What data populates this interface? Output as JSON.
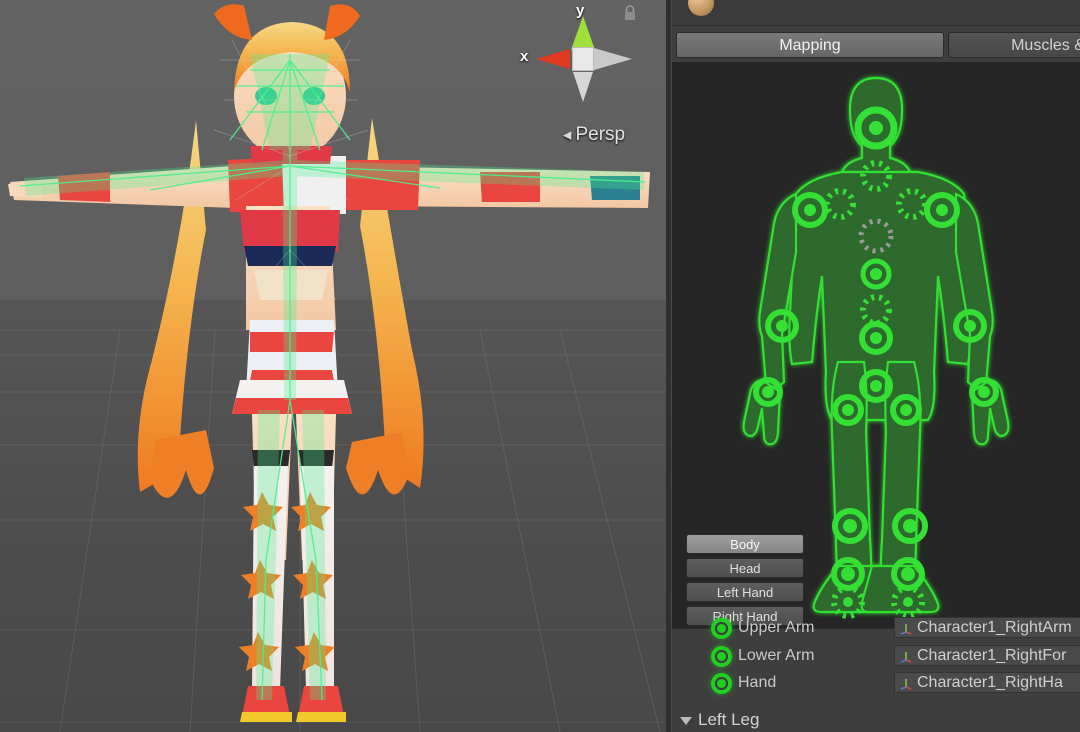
{
  "scene": {
    "gizmo": {
      "axis_x_label": "x",
      "axis_y_label": "y",
      "projection_label": "Persp",
      "projection_arrow": "◂",
      "lock_icon": "lock-icon"
    },
    "character_name": "humanoid-character-model",
    "pose": "T-pose"
  },
  "inspector": {
    "preview_icon": "material-sphere-icon",
    "tabs": [
      {
        "label": "Mapping",
        "active": true
      },
      {
        "label": "Muscles &",
        "active": false
      }
    ],
    "body_part_buttons": [
      {
        "label": "Body",
        "selected": true
      },
      {
        "label": "Head",
        "selected": false
      },
      {
        "label": "Left Hand",
        "selected": false
      },
      {
        "label": "Right Hand",
        "selected": false
      }
    ],
    "bone_rows": [
      {
        "label": "Upper Arm",
        "value": "Character1_RightArm",
        "mapped": true
      },
      {
        "label": "Lower Arm",
        "value": "Character1_RightFor",
        "mapped": true
      },
      {
        "label": "Hand",
        "value": "Character1_RightHa",
        "mapped": true
      }
    ],
    "foldout": {
      "label": "Left Leg",
      "expanded": true
    }
  },
  "colors": {
    "bone_green": "#1fd11f",
    "avatar_outline": "#2fe02f",
    "avatar_fill": "#2f6b2f",
    "panel_bg": "#3e3e3e",
    "avatar_bg": "#262626",
    "axis_x": "#e03a20",
    "axis_y": "#9ee03a"
  }
}
